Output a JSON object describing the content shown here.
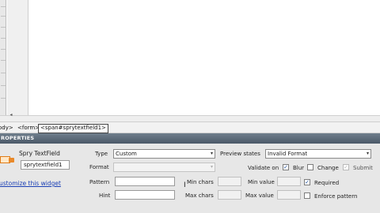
{
  "tag_selector": {
    "body": "ody>",
    "form": "<form>",
    "span": "<span#sprytextfield1>"
  },
  "panel": {
    "header": "ROPERTIES",
    "widget_type": "Spry TextField",
    "widget_name": "sprytextfield1",
    "customize_link": "ustomize this widget"
  },
  "fields": {
    "type_label": "Type",
    "type_value": "Custom",
    "format_label": "Format",
    "format_value": "",
    "pattern_label": "Pattern",
    "pattern_value": "",
    "hint_label": "Hint",
    "hint_value": "",
    "min_chars_label": "Min chars",
    "max_chars_label": "Max chars",
    "min_value_label": "Min value",
    "max_value_label": "Max value",
    "preview_states_label": "Preview states",
    "preview_states_value": "Invalid Format",
    "validate_on_label": "Validate on",
    "blur_label": "Blur",
    "change_label": "Change",
    "submit_label": "Submit",
    "required_label": "Required",
    "enforce_pattern_label": "Enforce pattern"
  },
  "checks": {
    "blur": "✓",
    "change": "",
    "submit": "✓",
    "required": "✓",
    "enforce_pattern": ""
  },
  "icons": {
    "dropdown": "▾",
    "scroll_left": "◂",
    "widget": "spry-textfield-icon",
    "cursor": "I"
  },
  "colors": {
    "header_bg": "#5b6a79",
    "panel_bg": "#e7e7e7",
    "link": "#1a3fb5"
  }
}
